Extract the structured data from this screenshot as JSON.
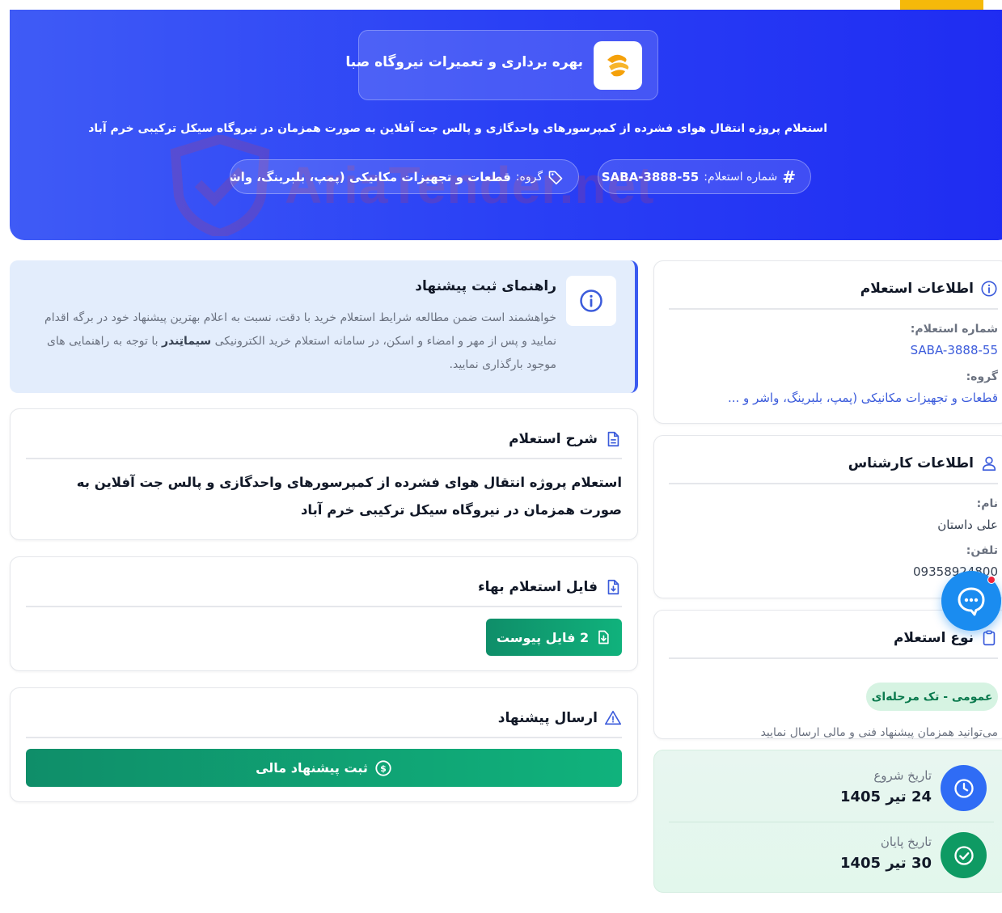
{
  "hero": {
    "company_name": "بهره برداری و تعمیرات نیروگاه صبا",
    "title": "استعلام پروژه انتقال هوای فشرده از کمپرسورهای واحدگازی و پالس جت آفلاین به صورت همزمان در نیروگاه سیکل ترکیبی خرم آباد",
    "number_label": "شماره استعلام:",
    "number_value": "SABA-3888-55",
    "group_label": "گروه:",
    "group_value": "قطعات و تجهیزات مکانیکی (پمپ، بلبرینگ، واشر و ..."
  },
  "watermark": {
    "text": "AriaTender.net"
  },
  "guide": {
    "title": "راهنمای ثبت پیشنهاد",
    "body_1": "خواهشمند است ضمن مطالعه شرایط استعلام خرید با دقت، نسبت به اعلام بهترین پیشنهاد خود در برگه اقدام نمایید و پس از مهر و امضاء و اسکن، در سامانه استعلام خرید الکترونیکی",
    "brand": "سیماتِندر",
    "body_2": "با توجه به راهنمایی های موجود بارگذاری نمایید."
  },
  "description": {
    "title": "شرح استعلام",
    "text": "استعلام پروژه انتقال هوای فشرده از کمپرسورهای واحدگازی و پالس جت آفلاین به صورت همزمان در نیروگاه سیکل ترکیبی خرم آباد"
  },
  "price_file": {
    "title": "فایل استعلام بهاء",
    "button": "2 فایل پیوست"
  },
  "submit": {
    "title": "ارسال پیشنهاد",
    "button": "ثبت پیشنهاد مالی"
  },
  "inquiry_info": {
    "title": "اطلاعات استعلام",
    "number_label": "شماره استعلام:",
    "number_value": "SABA-3888-55",
    "group_label": "گروه:",
    "group_value": "قطعات و تجهیزات مکانیکی (پمپ، بلبرینگ، واشر و ..."
  },
  "expert": {
    "title": "اطلاعات کارشناس",
    "name_label": "نام:",
    "name_value": "علی داستان",
    "phone_label": "تلفن:",
    "phone_value": "09358924800"
  },
  "type": {
    "title": "نوع استعلام",
    "badge": "عمومی - تک مرحله‌ای",
    "note": "می‌توانید همزمان پیشنهاد فنی و مالی ارسال نمایید"
  },
  "dates": {
    "start_label": "تاریخ شروع",
    "start_value": "24 تیر 1405",
    "end_label": "تاریخ پایان",
    "end_value": "30 تیر 1405"
  },
  "icons": {
    "hash": "hash-icon",
    "tag": "tag-icon",
    "info": "info-icon",
    "document": "document-icon",
    "download": "download-file-icon",
    "warning": "warning-icon",
    "user": "user-icon",
    "clipboard": "clipboard-icon",
    "clock": "clock-icon",
    "check": "check-circle-icon",
    "dollar": "dollar-icon",
    "chat": "chat-icon"
  },
  "colors": {
    "hero_blue": "#2a40f5",
    "green_button": "#10b27c",
    "link_blue": "#3b5bdb",
    "clock_circle": "#2f6cf5",
    "check_circle": "#0e9a63",
    "chat_fab": "#1a8cf0"
  }
}
